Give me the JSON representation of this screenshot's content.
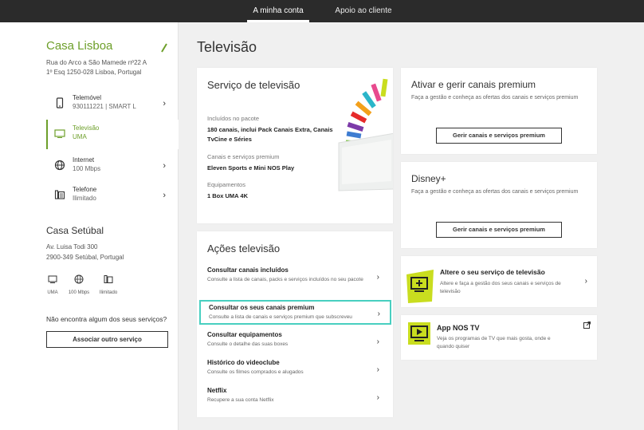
{
  "topnav": {
    "tabs": [
      {
        "label": "A minha conta",
        "active": true
      },
      {
        "label": "Apoio ao cliente",
        "active": false
      }
    ]
  },
  "sidebar": {
    "house1": {
      "title": "Casa Lisboa",
      "address_line1": "Rua do Arco a São Mamede nº22 A",
      "address_line2": "1º Esq 1250-028 Lisboa, Portugal",
      "services": [
        {
          "name": "Telemóvel",
          "detail": "930111221 | SMART L",
          "icon": "phone-icon",
          "active": false
        },
        {
          "name": "Televisão",
          "detail": "UMA",
          "icon": "tv-icon",
          "active": true
        },
        {
          "name": "Internet",
          "detail": "100 Mbps",
          "icon": "globe-icon",
          "active": false
        },
        {
          "name": "Telefone",
          "detail": "Ilimitado",
          "icon": "landline-phone-icon",
          "active": false
        }
      ]
    },
    "house2": {
      "title": "Casa Setúbal",
      "address_line1": "Av. Luisa Todi 300",
      "address_line2": "2900-349 Setúbal, Portugal",
      "services": [
        {
          "label": "UMA",
          "icon": "tv-icon"
        },
        {
          "label": "100 Mbps",
          "icon": "globe-icon"
        },
        {
          "label": "Ilimitado",
          "icon": "landline-phone-icon"
        }
      ]
    },
    "missing_text": "Não encontra algum dos seus serviços?",
    "associate_button": "Associar outro serviço"
  },
  "main": {
    "title": "Televisão",
    "tv_service": {
      "title": "Serviço de televisão",
      "included_label": "Incluídos no pacote",
      "included_value": "180 canais, inclui Pack Canais Extra, Canais TvCine e Séries",
      "premium_label": "Canais e serviços premium",
      "premium_value": "Eleven Sports e Mini NOS Play",
      "equipment_label": "Equipamentos",
      "equipment_value": "1 Box UMA 4K"
    },
    "actions": {
      "title": "Ações televisão",
      "items": [
        {
          "title": "Consultar canais incluídos",
          "subtitle": "Consulte a lista de canais, packs e serviços incluídos no seu pacote",
          "highlighted": false
        },
        {
          "title": "Consultar os seus canais premium",
          "subtitle": "Consulte a lista de canais e serviços premium que subscreveu",
          "highlighted": true
        },
        {
          "title": "Consultar equipamentos",
          "subtitle": "Consulte o detalhe das suas boxes",
          "highlighted": false
        },
        {
          "title": "Histórico do videoclube",
          "subtitle": "Consulte os filmes comprados e alugados",
          "highlighted": false
        },
        {
          "title": "Netflix",
          "subtitle": "Recupere a sua conta Netflix",
          "highlighted": false
        }
      ]
    },
    "premium": {
      "title": "Ativar e gerir canais premium",
      "subtitle": "Faça a gestão e conheça as ofertas dos canais e serviços premium",
      "button": "Gerir canais e serviços premium"
    },
    "disney": {
      "title": "Disney+",
      "subtitle": "Faça a gestão e conheça as ofertas dos canais e serviços premium",
      "button": "Gerir canais e serviços premium"
    },
    "change_service": {
      "title": "Altere o seu serviço de televisão",
      "subtitle": "Altere e faça a gestão dos seus canais e serviços de televisão"
    },
    "app": {
      "title": "App NOS TV",
      "subtitle": "Veja os programas de TV que mais gosta, onde e quando quiser"
    }
  },
  "colors": {
    "brand_green": "#6d9f2a",
    "topbar": "#2b2b2b",
    "highlight": "#48cfc0",
    "lime": "#c9dd1f"
  }
}
